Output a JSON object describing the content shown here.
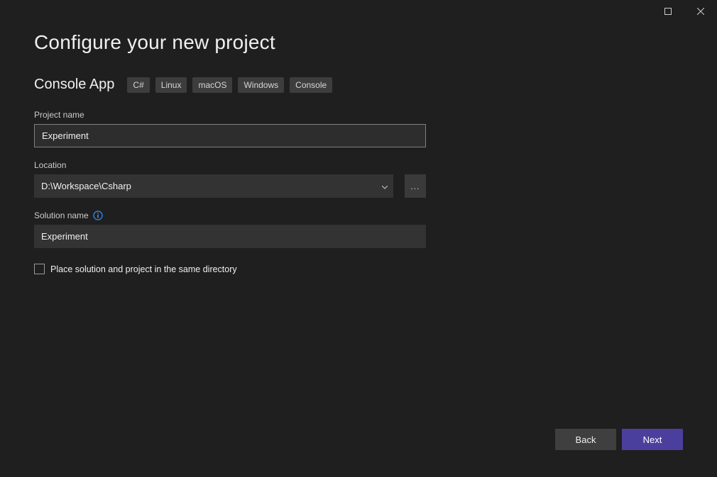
{
  "titlebar": {
    "maximize_label": "Maximize",
    "close_label": "Close"
  },
  "header": {
    "title": "Configure your new project",
    "subtitle": "Console App",
    "tags": [
      "C#",
      "Linux",
      "macOS",
      "Windows",
      "Console"
    ]
  },
  "fields": {
    "project_name": {
      "label": "Project name",
      "value": "Experiment"
    },
    "location": {
      "label": "Location",
      "value": "D:\\Workspace\\Csharp",
      "browse_label": "..."
    },
    "solution_name": {
      "label": "Solution name",
      "value": "Experiment",
      "info_tooltip": "Solution name information"
    },
    "same_directory": {
      "label": "Place solution and project in the same directory",
      "checked": false
    }
  },
  "footer": {
    "back_label": "Back",
    "next_label": "Next"
  }
}
